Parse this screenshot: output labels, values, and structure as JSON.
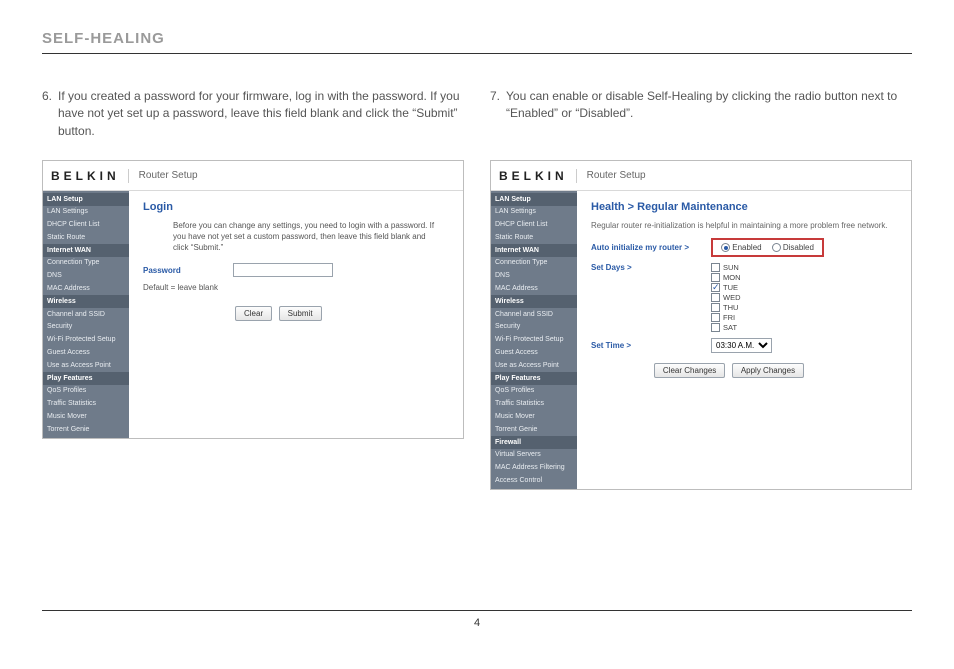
{
  "page_title": "SELF-HEALING",
  "page_number": "4",
  "step6": {
    "num": "6.",
    "text": "If you created a password for your firmware, log in with the password. If you have not yet set up a password, leave this field blank and click the “Submit” button."
  },
  "step7": {
    "num": "7.",
    "text": "You can enable or disable Self-Healing by clicking the radio button next to “Enabled” or “Disabled”."
  },
  "shot1": {
    "brand": "BELKIN",
    "sub": "Router Setup",
    "sidebar": [
      {
        "t": "LAN Setup",
        "hdr": true
      },
      {
        "t": "LAN Settings"
      },
      {
        "t": "DHCP Client List"
      },
      {
        "t": "Static Route"
      },
      {
        "t": "Internet WAN",
        "hdr": true
      },
      {
        "t": "Connection Type"
      },
      {
        "t": "DNS"
      },
      {
        "t": "MAC Address"
      },
      {
        "t": "Wireless",
        "hdr": true
      },
      {
        "t": "Channel and SSID"
      },
      {
        "t": "Security"
      },
      {
        "t": "Wi-Fi Protected Setup"
      },
      {
        "t": "Guest Access"
      },
      {
        "t": "Use as Access Point"
      },
      {
        "t": "Play Features",
        "hdr": true
      },
      {
        "t": "QoS Profiles"
      },
      {
        "t": "Traffic Statistics"
      },
      {
        "t": "Music Mover"
      },
      {
        "t": "Torrent Genie"
      }
    ],
    "title": "Login",
    "desc": "Before you can change any settings, you need to login with a password. If you have not yet set a custom password, then leave this field blank and click “Submit.”",
    "pwd_label": "Password",
    "hint": "Default = leave blank",
    "btn_clear": "Clear",
    "btn_submit": "Submit"
  },
  "shot2": {
    "brand": "BELKIN",
    "sub": "Router Setup",
    "sidebar": [
      {
        "t": "LAN Setup",
        "hdr": true
      },
      {
        "t": "LAN Settings"
      },
      {
        "t": "DHCP Client List"
      },
      {
        "t": "Static Route"
      },
      {
        "t": "Internet WAN",
        "hdr": true
      },
      {
        "t": "Connection Type"
      },
      {
        "t": "DNS"
      },
      {
        "t": "MAC Address"
      },
      {
        "t": "Wireless",
        "hdr": true
      },
      {
        "t": "Channel and SSID"
      },
      {
        "t": "Security"
      },
      {
        "t": "Wi-Fi Protected Setup"
      },
      {
        "t": "Guest Access"
      },
      {
        "t": "Use as Access Point"
      },
      {
        "t": "Play Features",
        "hdr": true
      },
      {
        "t": "QoS Profiles"
      },
      {
        "t": "Traffic Statistics"
      },
      {
        "t": "Music Mover"
      },
      {
        "t": "Torrent Genie"
      },
      {
        "t": "Firewall",
        "hdr": true
      },
      {
        "t": "Virtual Servers"
      },
      {
        "t": "MAC Address Filtering"
      },
      {
        "t": "Access Control"
      }
    ],
    "title": "Health > Regular Maintenance",
    "subdesc": "Regular router re-initialization is helpful in maintaining a more problem free network.",
    "auto_label": "Auto initialize my router >",
    "enabled": "Enabled",
    "disabled": "Disabled",
    "set_days": "Set Days >",
    "days": [
      {
        "t": "SUN",
        "c": false
      },
      {
        "t": "MON",
        "c": false
      },
      {
        "t": "TUE",
        "c": true
      },
      {
        "t": "WED",
        "c": false
      },
      {
        "t": "THU",
        "c": false
      },
      {
        "t": "FRI",
        "c": false
      },
      {
        "t": "SAT",
        "c": false
      }
    ],
    "set_time": "Set Time >",
    "time_value": "03:30 A.M.",
    "btn_clear": "Clear Changes",
    "btn_apply": "Apply Changes"
  }
}
